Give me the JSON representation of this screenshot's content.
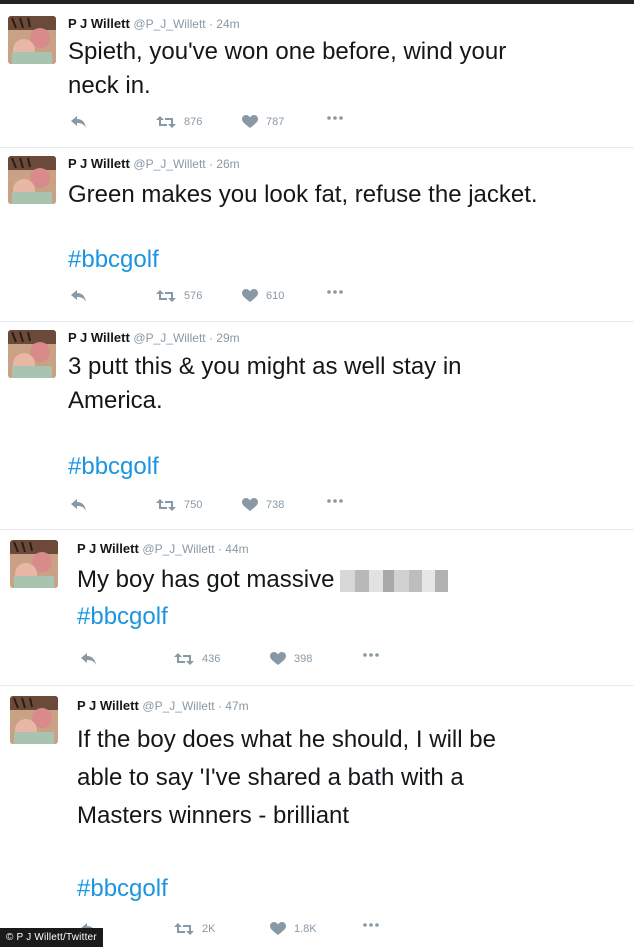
{
  "tweets": [
    {
      "name": "P J Willett",
      "handle": "@P_J_Willett",
      "time": "24m",
      "text_lines": [
        "Spieth, you've won one before, wind your",
        "neck in."
      ],
      "hashtag": "",
      "retweets": "876",
      "likes": "787"
    },
    {
      "name": "P J Willett",
      "handle": "@P_J_Willett",
      "time": "26m",
      "text_lines": [
        "Green makes you look fat, refuse the jacket."
      ],
      "hashtag": "#bbcgolf",
      "retweets": "576",
      "likes": "610"
    },
    {
      "name": "P J Willett",
      "handle": "@P_J_Willett",
      "time": "29m",
      "text_lines": [
        "3 putt this & you might as well stay in",
        "America."
      ],
      "hashtag": "#bbcgolf",
      "retweets": "750",
      "likes": "738"
    },
    {
      "name": "P J Willett",
      "handle": "@P_J_Willett",
      "time": "44m",
      "text_lines": [
        "My boy has got massive"
      ],
      "hashtag": "#bbcgolf",
      "retweets": "436",
      "likes": "398"
    },
    {
      "name": "P J Willett",
      "handle": "@P_J_Willett",
      "time": "47m",
      "text_lines": [
        "If the boy does what he should, I will be",
        "able to say 'I've shared a bath with a",
        "Masters winners - brilliant"
      ],
      "hashtag": "#bbcgolf",
      "retweets": "2K",
      "likes": "1.8K"
    }
  ],
  "credit": "© P J Willett/Twitter",
  "icons": {
    "reply": "reply-arrow-icon",
    "retweet": "retweet-icon",
    "like": "heart-icon",
    "more": "more-dots-icon"
  },
  "colors": {
    "text": "#14171a",
    "muted": "#8899a6",
    "hashtag": "#1b95e0",
    "separator": "#e6ecf0"
  }
}
